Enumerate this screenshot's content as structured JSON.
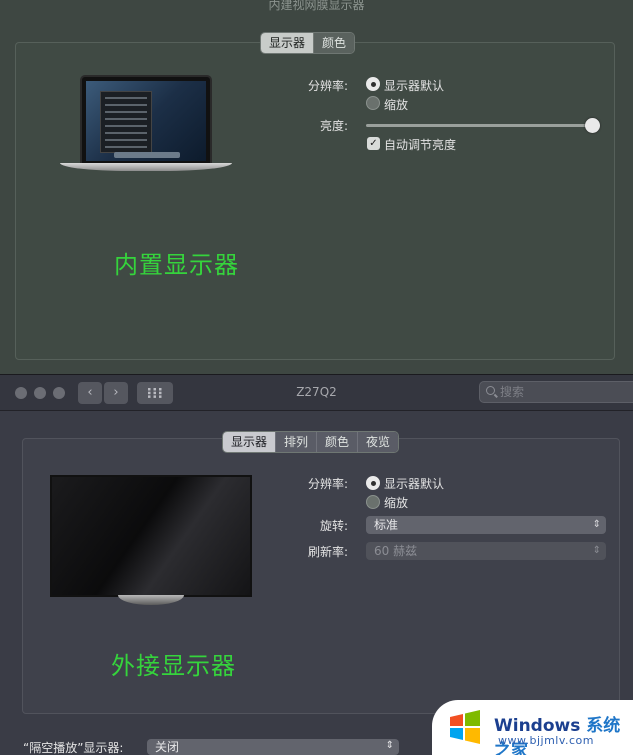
{
  "builtin": {
    "window_title": "内建视网膜显示器",
    "tabs": [
      "显示器",
      "颜色"
    ],
    "resolution_label": "分辨率:",
    "resolution_default": "显示器默认",
    "resolution_scaled": "缩放",
    "brightness_label": "亮度:",
    "brightness_level": 1.0,
    "auto_brightness_label": "自动调节亮度",
    "auto_brightness_checked": true,
    "caption": "内置显示器"
  },
  "external": {
    "window_title": "Z27Q2",
    "search_placeholder": "搜索",
    "tabs": [
      "显示器",
      "排列",
      "颜色",
      "夜览"
    ],
    "resolution_label": "分辨率:",
    "resolution_default": "显示器默认",
    "resolution_scaled": "缩放",
    "rotation_label": "旋转:",
    "rotation_value": "标准",
    "refresh_label": "刷新率:",
    "refresh_value": "60 赫兹",
    "caption": "外接显示器",
    "airplay_label": "“隔空播放”显示器:",
    "airplay_value": "关闭"
  },
  "watermark": {
    "brand": "Windows",
    "brand_suffix": "系统之家",
    "url": "www.bjjmlv.com"
  },
  "colors": {
    "caption_green": "#35d43c",
    "watermark_blue": "#1b3f8f"
  }
}
